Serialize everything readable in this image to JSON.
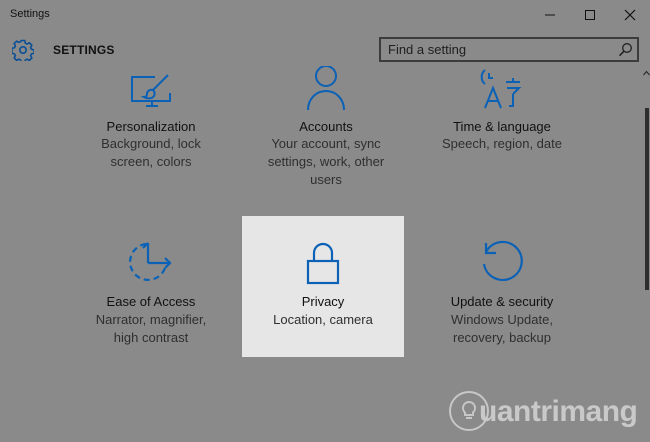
{
  "window": {
    "title": "Settings"
  },
  "header": {
    "heading": "SETTINGS",
    "search_placeholder": "Find a setting"
  },
  "accent_color": "#0a61b6",
  "tiles": [
    {
      "name": "Personalization",
      "desc": "Background, lock screen, colors",
      "icon": "personalization-icon"
    },
    {
      "name": "Accounts",
      "desc": "Your account, sync settings, work, other users",
      "icon": "accounts-icon"
    },
    {
      "name": "Time & language",
      "desc": "Speech, region, date",
      "icon": "time-language-icon"
    },
    {
      "name": "Ease of Access",
      "desc": "Narrator, magnifier, high contrast",
      "icon": "ease-of-access-icon"
    },
    {
      "name": "Privacy",
      "desc": "Location, camera",
      "icon": "lock-icon",
      "highlighted": true
    },
    {
      "name": "Update & security",
      "desc": "Windows Update, recovery, backup",
      "icon": "update-security-icon"
    }
  ],
  "watermark": {
    "text": "uantrimang"
  }
}
